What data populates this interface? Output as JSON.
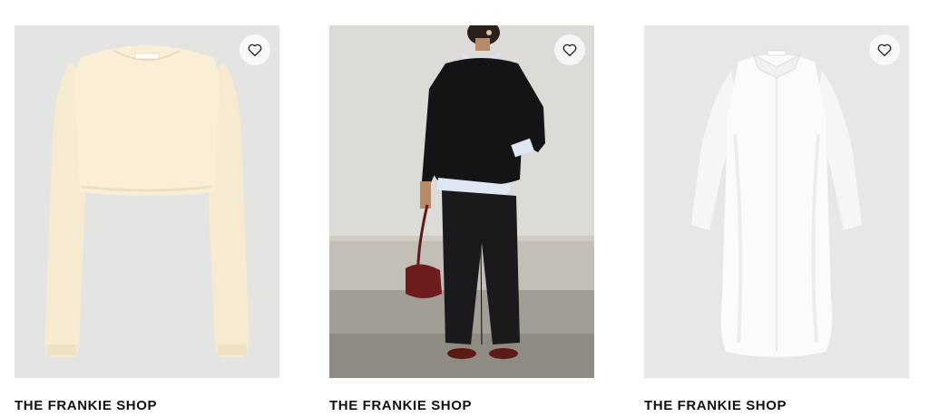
{
  "products": [
    {
      "brand": "THE FRANKIE SHOP",
      "garment": "cream-cropped-sweater",
      "bg": "#e4e4e2",
      "garment_color": "#f8edd3"
    },
    {
      "brand": "THE FRANKIE SHOP",
      "garment": "model-black-sweater-wide-pants",
      "bg": "#d9d8d5",
      "garment_color": "#141416"
    },
    {
      "brand": "THE FRANKIE SHOP",
      "garment": "white-shirt-dress",
      "bg": "#e7e7e5",
      "garment_color": "#fbfbfb"
    }
  ],
  "icons": {
    "favorite": "heart-outline-icon"
  }
}
